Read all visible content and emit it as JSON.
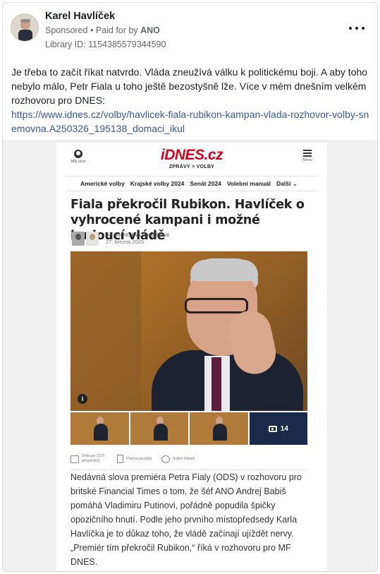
{
  "post": {
    "page_name": "Karel Havlíček",
    "sponsored_label": "Sponsored",
    "separator": "•",
    "paid_for_prefix": "Paid for by",
    "paid_for_by": "ANO",
    "library_id": "Library ID: 1154385579344590",
    "text": "Je třeba to začít říkat natvrdo. Vláda zneužívá válku k politickému boji. A aby toho nebylo málo, Petr Fiala u toho ještě bezostyšně lže. Více v mém dnešním velkém rozhovoru pro DNES:",
    "link": "https://www.idnes.cz/volby/havlicek-fiala-rubikon-kampan-vlada-rozhovor-volby-snemovna.A250326_195138_domaci_ikul"
  },
  "article": {
    "logo": "iDNES.cz",
    "account_label": "Můj účet",
    "menu_label": "Menu",
    "breadcrumb": "ZPRÁVY  >  VOLBY",
    "nav": [
      "Americké volby",
      "Krajské volby 2024",
      "Senát 2024",
      "Volební manuál",
      "Další"
    ],
    "headline": "Fiala překročil Rubikon. Havlíček o vyhrocené kampani i možné budoucí vládě",
    "authors": "Jiří Vachtl, Eva Pospíšilová",
    "date": "27. března 2025",
    "photo_count": "14",
    "info_label": "i",
    "actions": [
      "Diskuse (323 příspěvků)",
      "Přečíst později",
      "Sdílet článek"
    ],
    "body": "Nedávná slova premiéra Petra Fialy (ODS) v rozhovoru pro britské Financial Times o tom, že šéf ANO Andrej Babiš pomáhá Vladimiru Putinovi, pořádně popudila špičky opozičního hnutí. Podle jeho prvního místopředsedy Karla Havlíčka je to důkaz toho, že vládě začínají ujíždět nervy. „Premiér tím překročil Rubikon,“ říká v rozhovoru pro MF DNES."
  },
  "colors": {
    "link": "#385898",
    "brand_red": "#d6001c",
    "meta": "#65676b"
  },
  "icons": [
    "more-options-icon",
    "account-icon",
    "menu-icon",
    "info-icon",
    "camera-icon",
    "comment-icon",
    "bookmark-icon",
    "share-icon"
  ]
}
